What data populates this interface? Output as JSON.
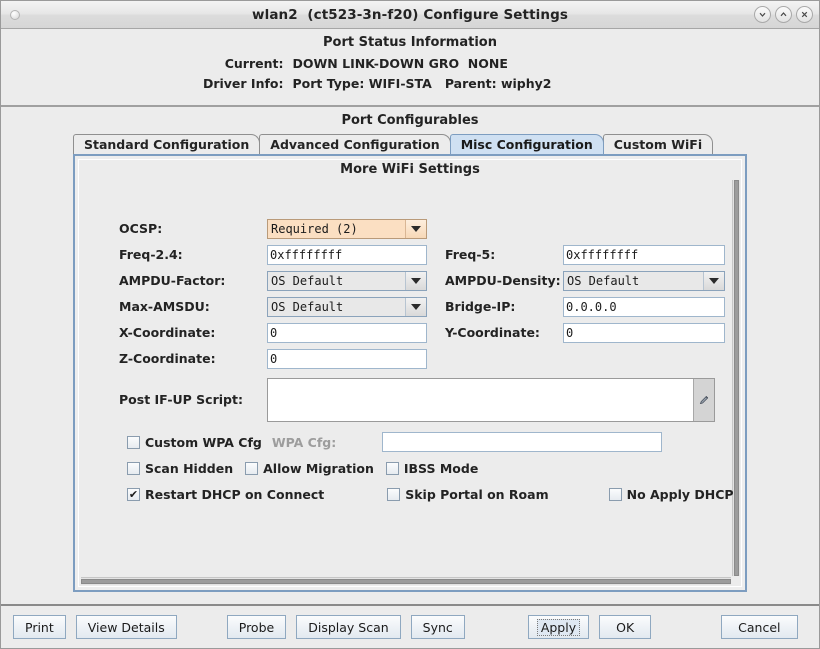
{
  "window": {
    "title": "wlan2  (ct523-3n-f20) Configure Settings",
    "buttons": [
      {
        "name": "minimize-button",
        "glyph": "chevron-down-icon"
      },
      {
        "name": "maximize-button",
        "glyph": "chevron-up-icon"
      },
      {
        "name": "close-button",
        "glyph": "close-icon"
      }
    ]
  },
  "status": {
    "heading": "Port Status Information",
    "rows": [
      {
        "label": "Current:",
        "value": "DOWN LINK-DOWN GRO  NONE"
      },
      {
        "label": "Driver Info:",
        "value": "Port Type: WIFI-STA   Parent: wiphy2"
      }
    ]
  },
  "configurables": {
    "heading": "Port Configurables",
    "tabs": [
      {
        "label": "Standard Configuration",
        "active": false
      },
      {
        "label": "Advanced Configuration",
        "active": false
      },
      {
        "label": "Misc Configuration",
        "active": true
      },
      {
        "label": "Custom WiFi",
        "active": false
      }
    ],
    "panel_title": "More WiFi Settings"
  },
  "form": {
    "ocsp": {
      "label": "OCSP:",
      "value": "Required (2)"
    },
    "freq24": {
      "label": "Freq-2.4:",
      "value": "0xffffffff"
    },
    "freq5": {
      "label": "Freq-5:",
      "value": "0xffffffff"
    },
    "ampdu_factor": {
      "label": "AMPDU-Factor:",
      "value": "OS Default"
    },
    "ampdu_density": {
      "label": "AMPDU-Density:",
      "value": "OS Default"
    },
    "max_amsdu": {
      "label": "Max-AMSDU:",
      "value": "OS Default"
    },
    "bridge_ip": {
      "label": "Bridge-IP:",
      "value": "0.0.0.0"
    },
    "x_coord": {
      "label": "X-Coordinate:",
      "value": "0"
    },
    "y_coord": {
      "label": "Y-Coordinate:",
      "value": "0"
    },
    "z_coord": {
      "label": "Z-Coordinate:",
      "value": "0"
    },
    "post_ifup": {
      "label": "Post IF-UP Script:",
      "value": ""
    },
    "wpa_cfg": {
      "label": "WPA Cfg:",
      "value": ""
    },
    "checkboxes": {
      "custom_wpa_cfg": {
        "label": "Custom WPA Cfg",
        "checked": false
      },
      "scan_hidden": {
        "label": "Scan Hidden",
        "checked": false
      },
      "allow_migration": {
        "label": "Allow Migration",
        "checked": false
      },
      "ibss_mode": {
        "label": "IBSS Mode",
        "checked": false
      },
      "restart_dhcp": {
        "label": "Restart DHCP on Connect",
        "checked": true
      },
      "skip_portal": {
        "label": "Skip Portal on Roam",
        "checked": false
      },
      "no_apply_dhcp": {
        "label": "No Apply DHCP",
        "checked": false
      }
    }
  },
  "footer": {
    "print": "Print",
    "view_details": "View Details",
    "probe": "Probe",
    "display_scan": "Display Scan",
    "sync": "Sync",
    "apply": "Apply",
    "ok": "OK",
    "cancel": "Cancel"
  },
  "colors": {
    "accent": "#7d9dc0",
    "active_tab": "#cfe0f2",
    "highlight_field": "#fbdfc2",
    "window_bg": "#ececec"
  }
}
